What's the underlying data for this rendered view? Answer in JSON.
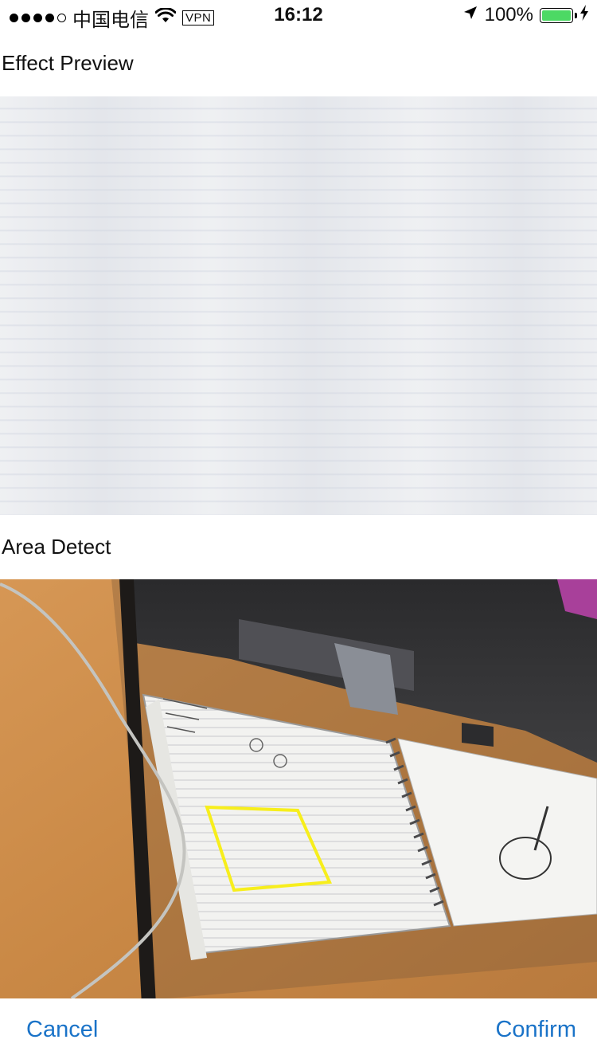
{
  "status_bar": {
    "carrier": "中国电信",
    "vpn": "VPN",
    "time": "16:12",
    "battery_percent": "100%",
    "battery_level": 1.0,
    "signal_bars": 4,
    "signal_max": 5
  },
  "sections": {
    "preview_label": "Effect Preview",
    "detect_label": "Area Detect"
  },
  "actions": {
    "cancel": "Cancel",
    "confirm": "Confirm"
  },
  "colors": {
    "accent": "#1a73c8",
    "battery": "#4cd964",
    "detect_frame": "#f7ee1c"
  },
  "icons": [
    "signal-dots-icon",
    "wifi-icon",
    "location-arrow-icon",
    "battery-icon",
    "charging-bolt-icon"
  ]
}
